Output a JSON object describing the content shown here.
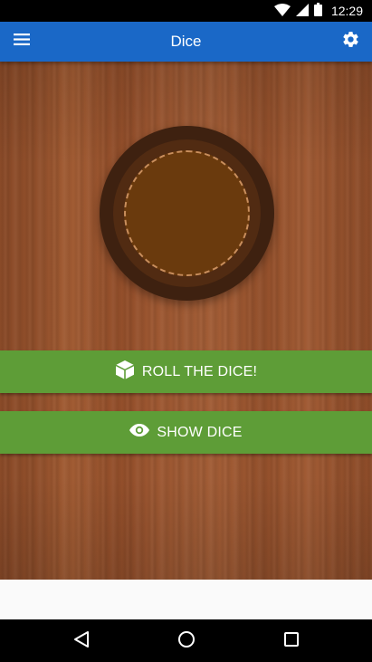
{
  "status_bar": {
    "time": "12:29",
    "icons": [
      "wifi-icon",
      "signal-icon",
      "battery-icon"
    ]
  },
  "app_bar": {
    "title": "Dice",
    "menu_icon": "menu-icon",
    "settings_icon": "gear-icon",
    "color": "#1a68c7"
  },
  "main": {
    "roll_button": {
      "label": "ROLL THE DICE!",
      "icon": "cube-icon"
    },
    "show_button": {
      "label": "SHOW DICE",
      "icon": "eye-icon"
    },
    "button_color": "#5e9d37"
  },
  "nav_bar": {
    "buttons": [
      "back-icon",
      "home-icon",
      "recents-icon"
    ]
  }
}
